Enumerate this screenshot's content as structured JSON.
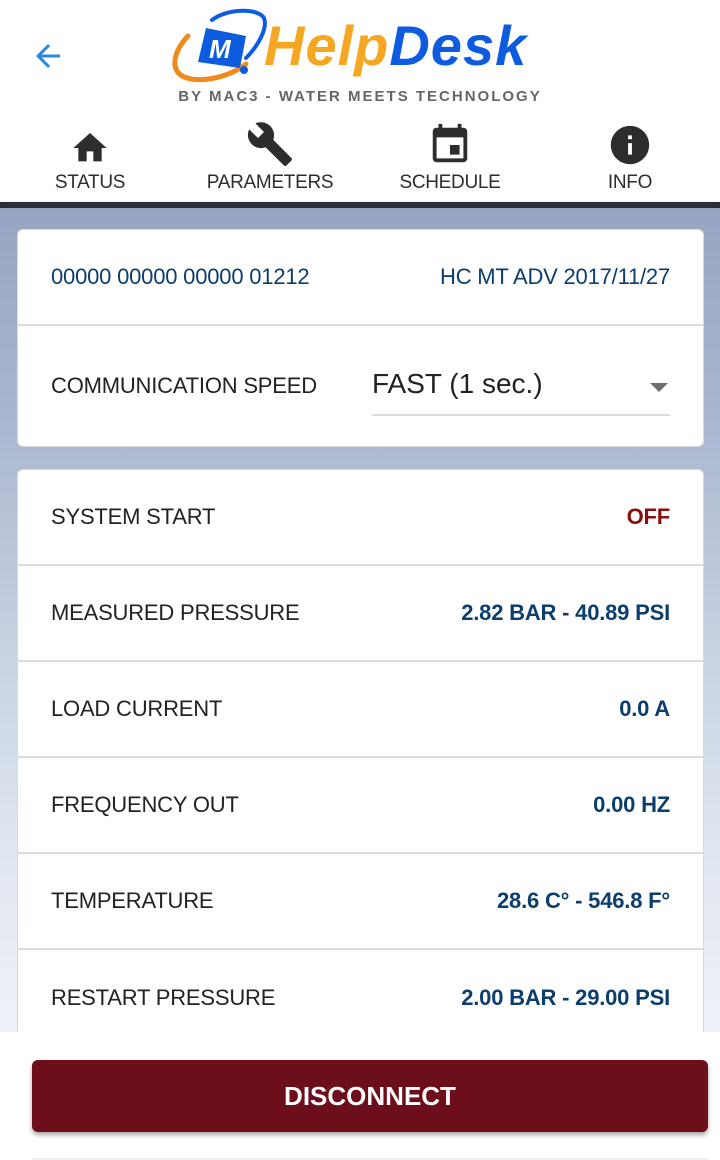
{
  "header": {
    "back_icon": "arrow-left-icon",
    "logo": {
      "part1": "Help",
      "part2": "Desk",
      "mark": "M."
    },
    "tagline": "BY MAC3 - WATER MEETS TECHNOLOGY"
  },
  "tabs": [
    {
      "label": "STATUS",
      "icon": "home-icon"
    },
    {
      "label": "PARAMETERS",
      "icon": "wrench-icon"
    },
    {
      "label": "SCHEDULE",
      "icon": "calendar-icon"
    },
    {
      "label": "INFO",
      "icon": "info-icon"
    }
  ],
  "device": {
    "serial": "00000 00000 00000 01212",
    "model": "HC MT ADV 2017/11/27"
  },
  "communication_speed": {
    "label": "COMMUNICATION SPEED",
    "selected": "FAST (1 sec.)"
  },
  "status_rows": [
    {
      "label": "SYSTEM START",
      "value": "OFF"
    },
    {
      "label": "MEASURED PRESSURE",
      "value": "2.82 BAR - 40.89 PSI"
    },
    {
      "label": "LOAD CURRENT",
      "value": "0.0 A"
    },
    {
      "label": "FREQUENCY OUT",
      "value": "0.00 HZ"
    },
    {
      "label": "TEMPERATURE",
      "value": "28.6 C° - 546.8 F°"
    },
    {
      "label": "RESTART PRESSURE",
      "value": "2.00 BAR - 29.00 PSI"
    }
  ],
  "footer": {
    "disconnect_label": "DISCONNECT"
  },
  "colors": {
    "accent_blue": "#0b3d6e",
    "off_red": "#8b0e0e",
    "disconnect_bg": "#6d0e1b",
    "logo_orange": "#f5a623",
    "logo_blue": "#0d5ce0",
    "back_arrow": "#2b8ad8"
  }
}
